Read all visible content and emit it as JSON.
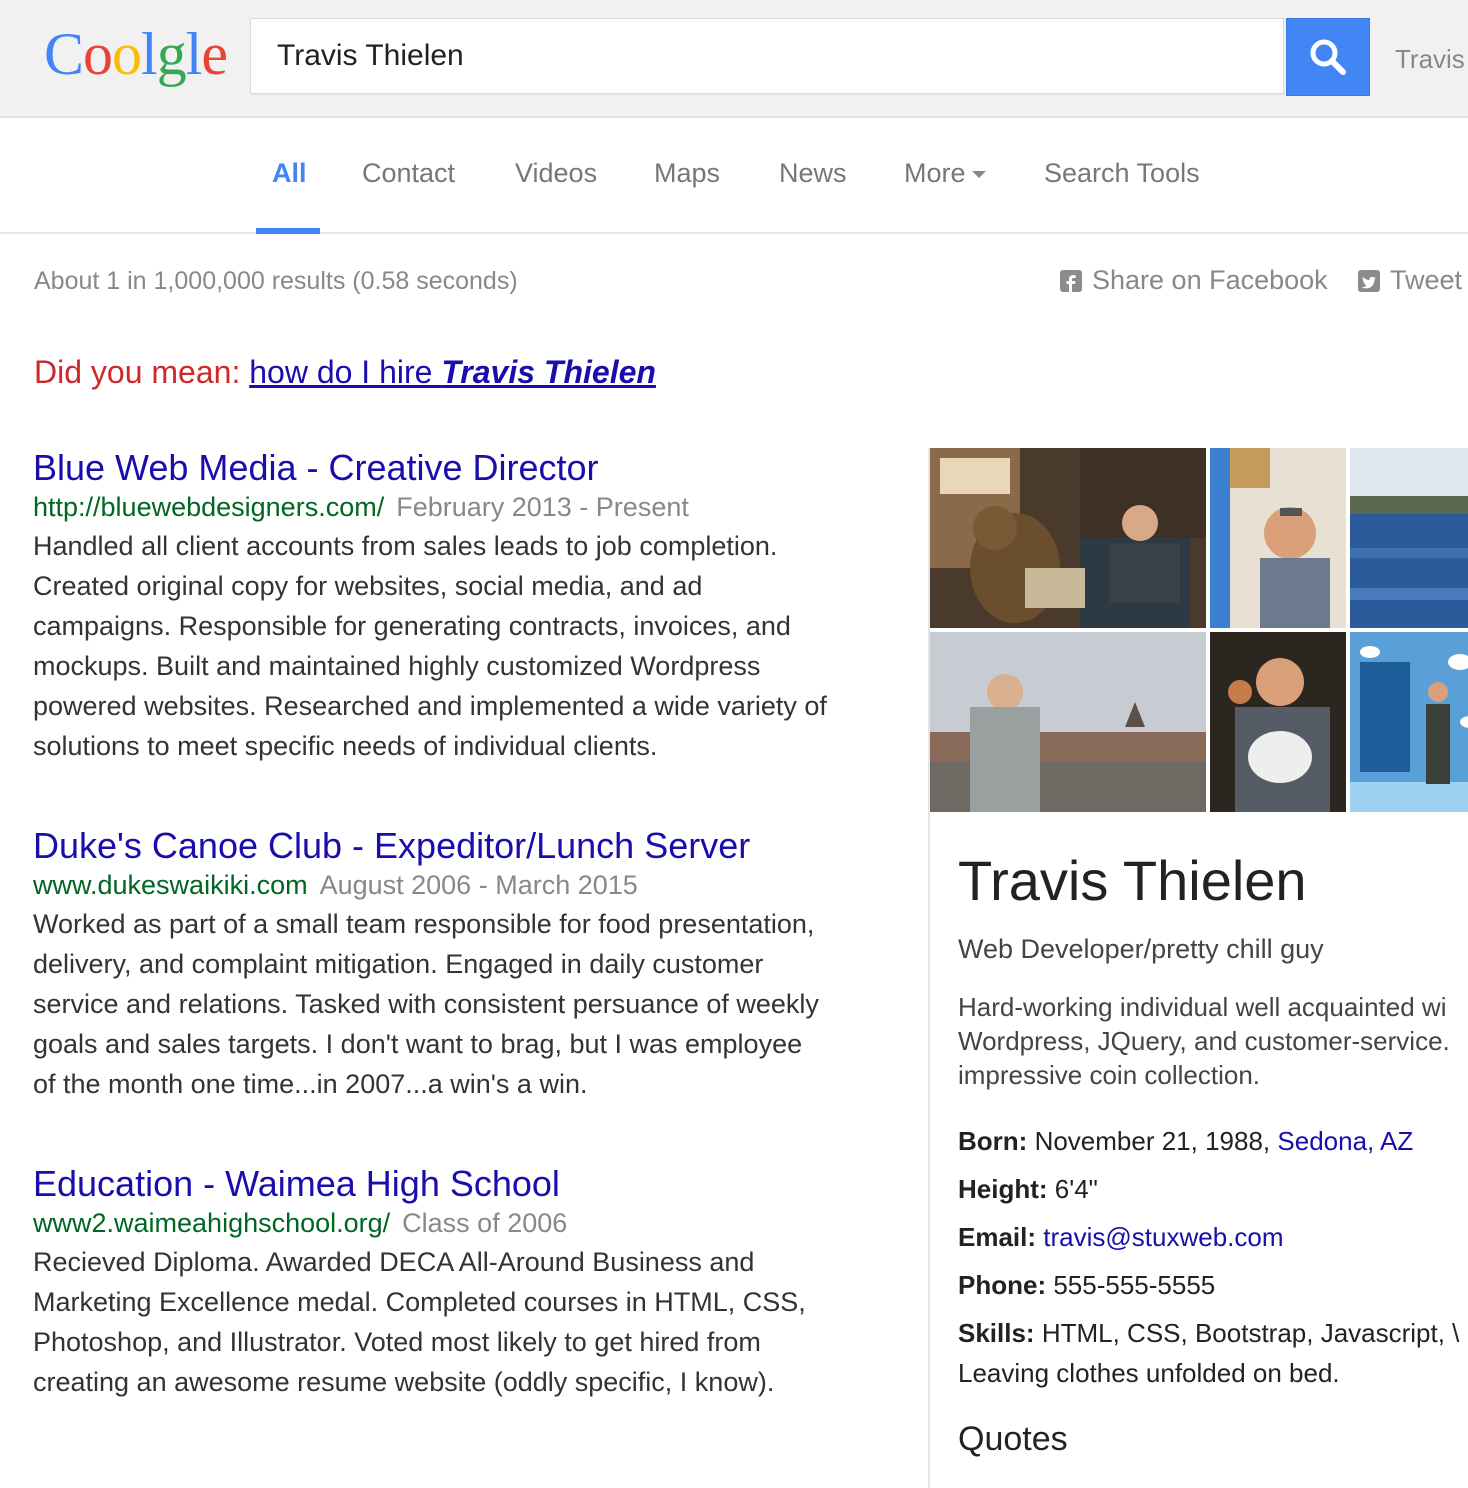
{
  "header": {
    "logo_letters": [
      {
        "char": "C",
        "color": "#4285f4"
      },
      {
        "char": "o",
        "color": "#ea4335"
      },
      {
        "char": "o",
        "color": "#fbbc05"
      },
      {
        "char": "l",
        "color": "#4285f4"
      },
      {
        "char": "g",
        "color": "#34a853"
      },
      {
        "char": "l",
        "color": "#4285f4"
      },
      {
        "char": "e",
        "color": "#ea4335"
      }
    ],
    "search_value": "Travis Thielen",
    "search_icon": "search-icon",
    "user_name": "Travis"
  },
  "tabs": [
    {
      "label": "All",
      "active": true
    },
    {
      "label": "Contact"
    },
    {
      "label": "Videos"
    },
    {
      "label": "Maps"
    },
    {
      "label": "News"
    },
    {
      "label": "More"
    },
    {
      "label": "Search Tools"
    }
  ],
  "stats": "About 1 in 1,000,000 results (0.58 seconds)",
  "share": {
    "facebook": "Share on Facebook",
    "tweet": "Tweet"
  },
  "did_you_mean": {
    "label": "Did you mean:",
    "link_plain": "how do I hire ",
    "link_emph": "Travis Thielen"
  },
  "results": [
    {
      "title": "Blue Web Media - Creative Director",
      "url": "http://bluewebdesigners.com/",
      "date": "February 2013 - Present",
      "desc": "Handled all client accounts from sales leads to job completion.\nCreated original copy for websites, social media, and ad\ncampaigns. Responsible for generating contracts, invoices, and\nmockups. Built and maintained highly customized Wordpress\npowered websites. Researched and implemented a wide variety of\nsolutions to meet specific needs of individual clients."
    },
    {
      "title": "Duke's Canoe Club - Expeditor/Lunch Server",
      "url": "www.dukeswaikiki.com",
      "date": "August 2006 - March 2015",
      "desc": "Worked as part of a small team responsible for food presentation,\ndelivery, and complaint mitigation. Engaged in daily customer\nservice and relations. Tasked with consistent persuance of weekly\ngoals and sales targets. I don't want to brag, but I was employee\nof the month one time...in 2007...a win's a win."
    },
    {
      "title": "Education - Waimea High School",
      "url": "www2.waimeahighschool.org/",
      "date": "Class of 2006",
      "desc": "Recieved Diploma. Awarded DECA All-Around Business and\nMarketing Excellence medal. Completed courses in HTML, CSS,\nPhotoshop, and Illustrator. Voted most likely to get hired from\ncreating an awesome resume website (oddly specific, I know)."
    }
  ],
  "knowledge_panel": {
    "name": "Travis Thielen",
    "subtitle": "Web Developer/pretty chill guy",
    "description": "Hard-working individual well acquainted wi\nWordpress, JQuery, and customer-service.\nimpressive coin collection.",
    "born_label": "Born:",
    "born_value": "November 21, 1988,",
    "born_place": "Sedona, AZ",
    "height_label": "Height:",
    "height_value": "6'4\"",
    "email_label": "Email:",
    "email_value": "travis@stuxweb.com",
    "phone_label": "Phone:",
    "phone_value": "555-555-5555",
    "skills_label": "Skills:",
    "skills_value": "HTML, CSS, Bootstrap, Javascript, \\",
    "skills_line2": "Leaving clothes unfolded on bed.",
    "quotes_heading": "Quotes"
  }
}
